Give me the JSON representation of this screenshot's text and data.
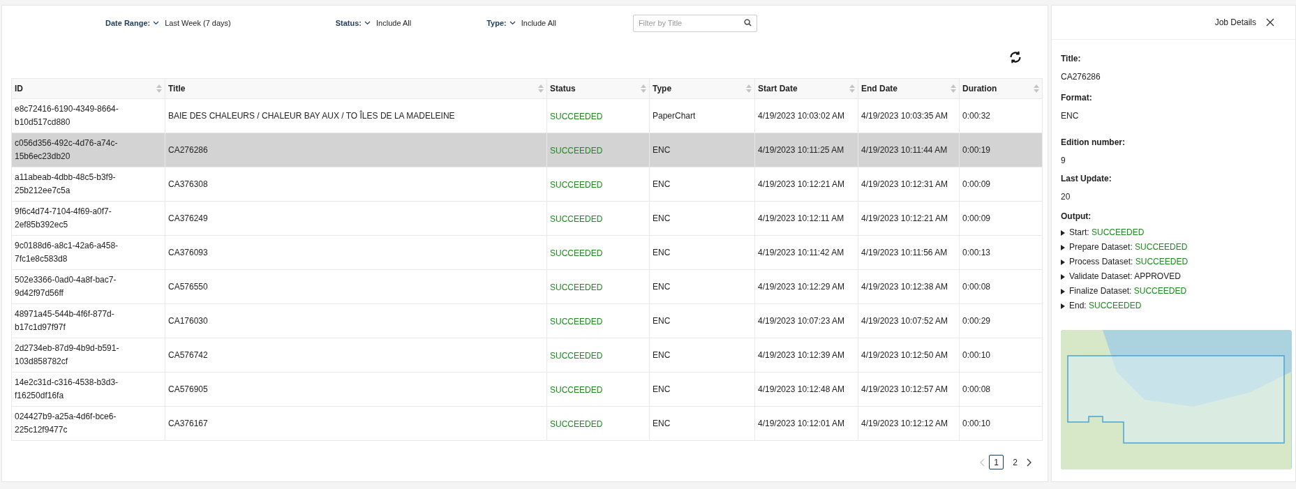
{
  "filters": [
    {
      "label": "Date Range:",
      "value": "Last Week (7 days)"
    },
    {
      "label": "Status:",
      "value": "Include All"
    },
    {
      "label": "Type:",
      "value": "Include All"
    }
  ],
  "search": {
    "placeholder": "Filter by Title"
  },
  "table": {
    "columns": [
      "ID",
      "Title",
      "Status",
      "Type",
      "Start Date",
      "End Date",
      "Duration"
    ],
    "rows": [
      {
        "selected": false,
        "cells": [
          "e8c72416-6190-4349-8664-b10d517cd880",
          "BAIE DES CHALEURS / CHALEUR BAY AUX / TO ÎLES DE LA MADELEINE",
          "SUCCEEDED",
          "PaperChart",
          "4/19/2023 10:03:02 AM",
          "4/19/2023 10:03:35 AM",
          "0:00:32"
        ]
      },
      {
        "selected": true,
        "cells": [
          "c056d356-492c-4d76-a74c-15b6ec23db20",
          "CA276286",
          "SUCCEEDED",
          "ENC",
          "4/19/2023 10:11:25 AM",
          "4/19/2023 10:11:44 AM",
          "0:00:19"
        ]
      },
      {
        "selected": false,
        "cells": [
          "a11abeab-4dbb-48c5-b3f9-25b212ee7c5a",
          "CA376308",
          "SUCCEEDED",
          "ENC",
          "4/19/2023 10:12:21 AM",
          "4/19/2023 10:12:31 AM",
          "0:00:09"
        ]
      },
      {
        "selected": false,
        "cells": [
          "9f6c4d74-7104-4f69-a0f7-2ef85b392ec5",
          "CA376249",
          "SUCCEEDED",
          "ENC",
          "4/19/2023 10:12:11 AM",
          "4/19/2023 10:12:21 AM",
          "0:00:09"
        ]
      },
      {
        "selected": false,
        "cells": [
          "9c0188d6-a8c1-42a6-a458-7fc1e8c583d8",
          "CA376093",
          "SUCCEEDED",
          "ENC",
          "4/19/2023 10:11:42 AM",
          "4/19/2023 10:11:56 AM",
          "0:00:13"
        ]
      },
      {
        "selected": false,
        "cells": [
          "502e3366-0ad0-4a8f-bac7-9d42f97d56ff",
          "CA576550",
          "SUCCEEDED",
          "ENC",
          "4/19/2023 10:12:29 AM",
          "4/19/2023 10:12:38 AM",
          "0:00:08"
        ]
      },
      {
        "selected": false,
        "cells": [
          "48971a45-544b-4f6f-877d-b17c1d97f97f",
          "CA176030",
          "SUCCEEDED",
          "ENC",
          "4/19/2023 10:07:23 AM",
          "4/19/2023 10:07:52 AM",
          "0:00:29"
        ]
      },
      {
        "selected": false,
        "cells": [
          "2d2734eb-87d9-4b9d-b591-103d858782cf",
          "CA576742",
          "SUCCEEDED",
          "ENC",
          "4/19/2023 10:12:39 AM",
          "4/19/2023 10:12:50 AM",
          "0:00:10"
        ]
      },
      {
        "selected": false,
        "cells": [
          "14e2c31d-c316-4538-b3d3-f16250df16fa",
          "CA576905",
          "SUCCEEDED",
          "ENC",
          "4/19/2023 10:12:48 AM",
          "4/19/2023 10:12:57 AM",
          "0:00:08"
        ]
      },
      {
        "selected": false,
        "cells": [
          "024427b9-a25a-4d6f-bce6-225c12f9477c",
          "CA376167",
          "SUCCEEDED",
          "ENC",
          "4/19/2023 10:12:01 AM",
          "4/19/2023 10:12:12 AM",
          "0:00:10"
        ]
      }
    ]
  },
  "pagination": {
    "prev_disabled": true,
    "pages": [
      {
        "label": "1",
        "selected": true
      },
      {
        "label": "2",
        "selected": false
      }
    ]
  },
  "details": {
    "title": "Job Details",
    "fields": [
      {
        "label": "Title:",
        "value": "CA276286"
      },
      {
        "label": "Format:",
        "value": "ENC"
      },
      {
        "label": "Edition number:",
        "value": "9"
      },
      {
        "label": "Last Update:",
        "value": "20"
      }
    ],
    "output_label": "Output:",
    "steps": [
      {
        "name": "Start:",
        "status": "SUCCEEDED",
        "kind": "success"
      },
      {
        "name": "Prepare Dataset:",
        "status": "SUCCEEDED",
        "kind": "success"
      },
      {
        "name": "Process Dataset:",
        "status": "SUCCEEDED",
        "kind": "success"
      },
      {
        "name": "Validate Dataset:",
        "status": "APPROVED",
        "kind": "neutral"
      },
      {
        "name": "Finalize Dataset:",
        "status": "SUCCEEDED",
        "kind": "success"
      },
      {
        "name": "End:",
        "status": "SUCCEEDED",
        "kind": "success"
      }
    ]
  }
}
